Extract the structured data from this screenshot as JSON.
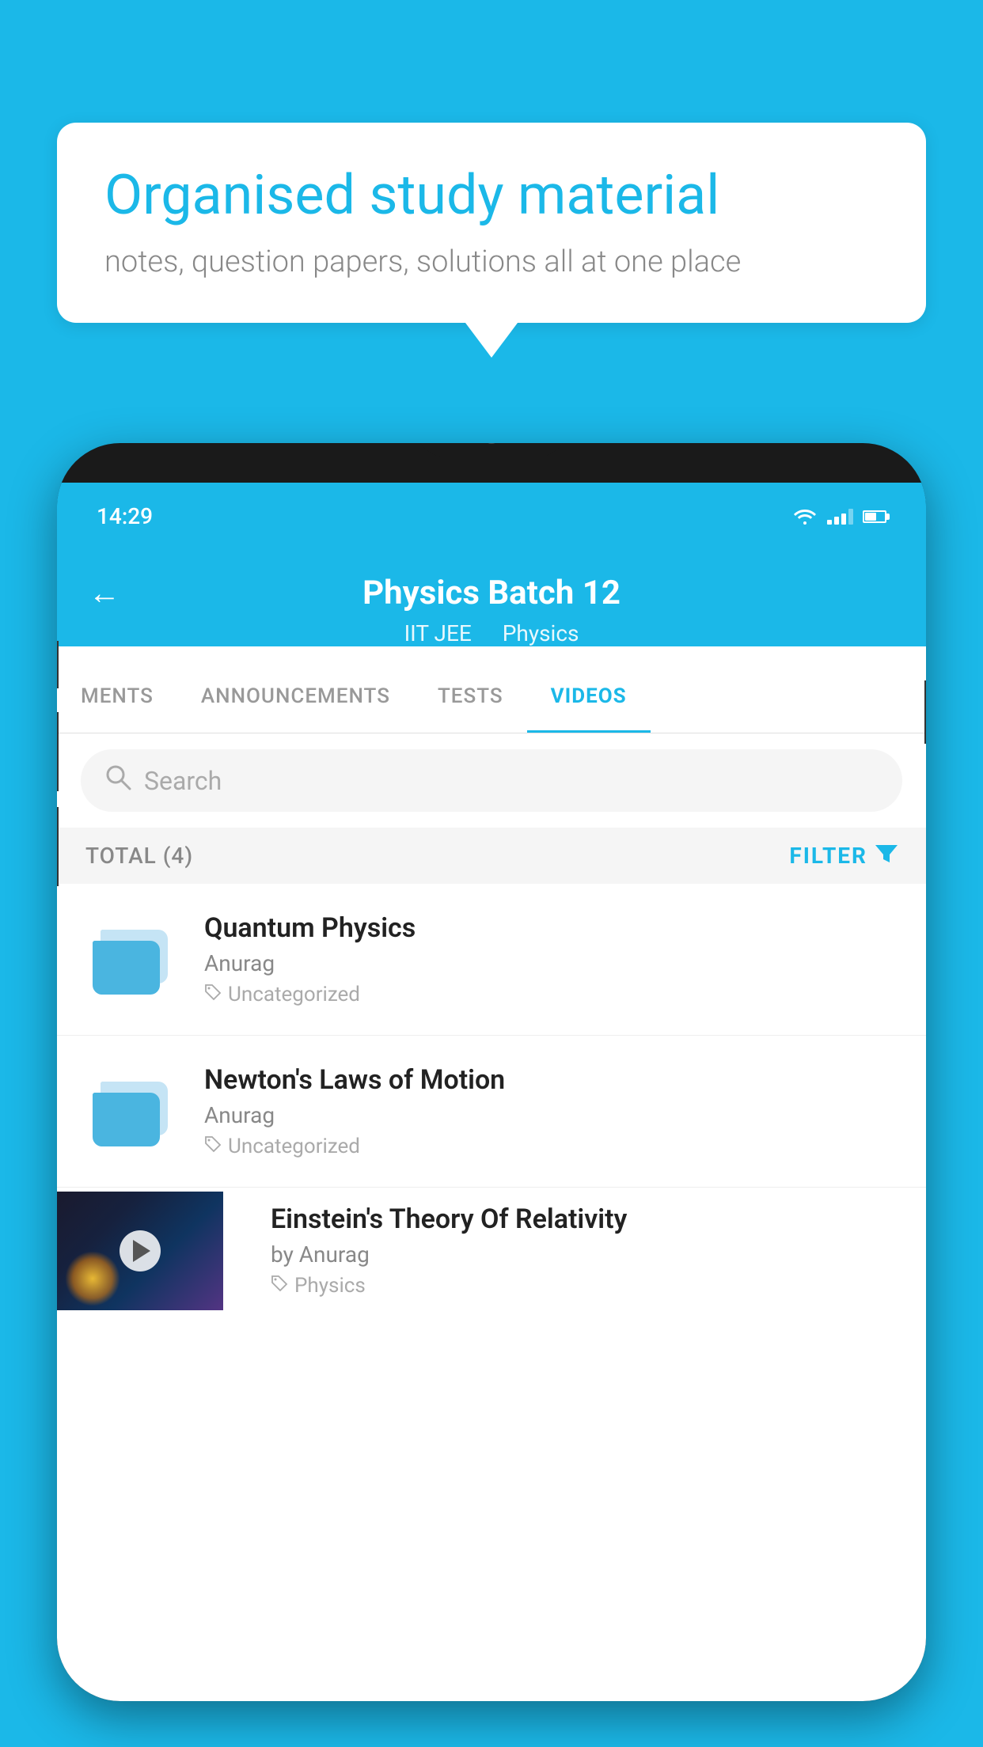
{
  "background": {
    "color": "#1BB8E8"
  },
  "speech_bubble": {
    "title": "Organised study material",
    "subtitle": "notes, question papers, solutions all at one place"
  },
  "phone": {
    "status_bar": {
      "time": "14:29"
    },
    "header": {
      "title": "Physics Batch 12",
      "subtitle_part1": "IIT JEE",
      "subtitle_part2": "Physics",
      "back_label": "←"
    },
    "tabs": [
      {
        "label": "MENTS",
        "active": false
      },
      {
        "label": "ANNOUNCEMENTS",
        "active": false
      },
      {
        "label": "TESTS",
        "active": false
      },
      {
        "label": "VIDEOS",
        "active": true
      }
    ],
    "search": {
      "placeholder": "Search"
    },
    "filter_row": {
      "total_label": "TOTAL (4)",
      "filter_label": "FILTER"
    },
    "videos": [
      {
        "title": "Quantum Physics",
        "author": "Anurag",
        "tag": "Uncategorized",
        "type": "folder"
      },
      {
        "title": "Newton's Laws of Motion",
        "author": "Anurag",
        "tag": "Uncategorized",
        "type": "folder"
      },
      {
        "title": "Einstein's Theory Of Relativity",
        "author": "by Anurag",
        "tag": "Physics",
        "type": "video"
      }
    ]
  }
}
